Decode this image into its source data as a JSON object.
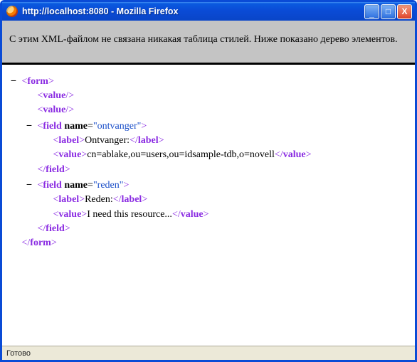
{
  "window": {
    "title": "http://localhost:8080 - Mozilla Firefox",
    "controls": {
      "min": "_",
      "max": "□",
      "close": "X"
    }
  },
  "notice": "С этим XML-файлом не связана никакая таблица стилей. Ниже показано дерево элементов.",
  "xml": {
    "root": "form",
    "emptyValue": "value",
    "fieldTag": "field",
    "labelTag": "label",
    "valueTag": "value",
    "attrName": "name",
    "fields": [
      {
        "name": "ontvanger",
        "label": "Ontvanger:",
        "value": "cn=ablake,ou=users,ou=idsample-tdb,o=novell"
      },
      {
        "name": "reden",
        "label": "Reden:",
        "value": "I need this resource..."
      }
    ]
  },
  "status": "Готово",
  "glyph": {
    "minus": "−"
  }
}
